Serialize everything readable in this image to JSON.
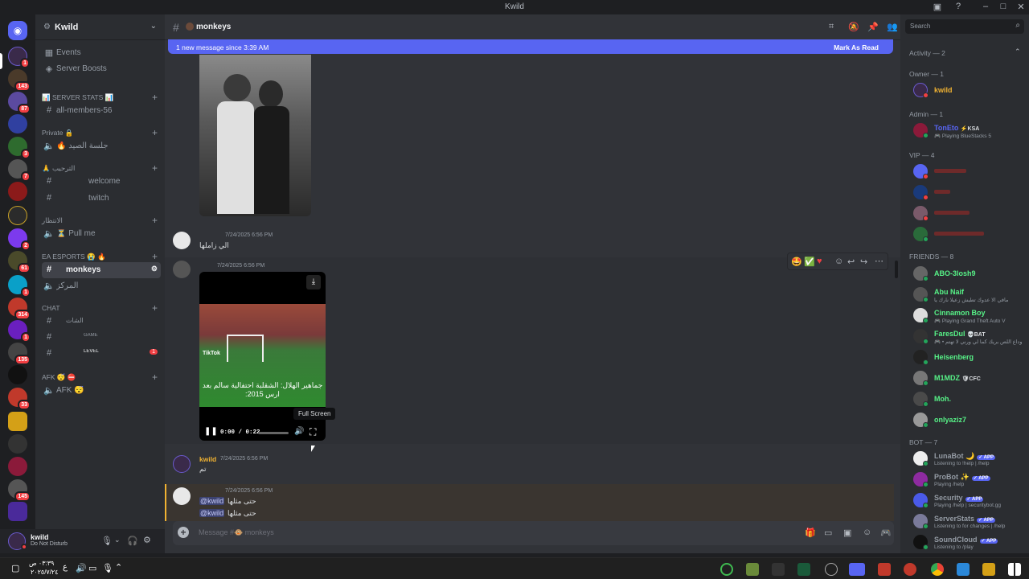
{
  "window": {
    "title": "Kwild"
  },
  "server": {
    "name": "Kwild",
    "events_label": "Events",
    "boosts_label": "Server Boosts"
  },
  "channels": {
    "server_stats_cat": "📊 SERVER STATS 📊",
    "all_members": "all-members-56",
    "private_cat": "Private 🔒",
    "private_voice": "🔥 جلسة الصيد",
    "welcome_cat": "🙏 الترحيب",
    "welcome": "welcome",
    "twitch": "twitch",
    "wait_cat": "الانتظار",
    "pull_me": "⏳ Pull me",
    "esports_cat": "EA ESPORTS 😭 🔥",
    "monkeys": "monkeys",
    "center": "المركز",
    "chat_cat": "CHAT",
    "chat1": "الشات",
    "chat2": "GAME",
    "chat3": "LEVEL",
    "chat3_badge": "1",
    "afk_cat": "AFK 😴 ⛔",
    "afk": "AFK 😴"
  },
  "user_panel": {
    "name": "kwild",
    "status": "Do Not Disturb"
  },
  "chat_header": {
    "channel": "monkeys"
  },
  "banner": {
    "text": "1 new message since 3:39 AM",
    "action": "Mark As Read"
  },
  "messages": [
    {
      "author": "",
      "time": "7/24/2025 6:56 PM",
      "text": "الي زاملها"
    },
    {
      "author": "",
      "time": "7/24/2025 6:56 PM",
      "video_time": "0:00 / 0:22",
      "video_caption": "جماهير الهلال: الشقلبة احتفالية سالم بعد ارس 2015:",
      "video_watermark": "TikTok",
      "tooltip": "Full Screen",
      "progress": 0.0
    },
    {
      "author": "kwild",
      "time": "7/24/2025 6:56 PM",
      "text": "تم"
    },
    {
      "author": "",
      "time": "7/24/2025 6:56 PM",
      "line1_mention": "@kwild",
      "line1_text": "حتى مثلها",
      "line2_mention": "@kwild",
      "line2_text": "حتى مثلها"
    }
  ],
  "composer": {
    "placeholder": "Message #🐵 monkeys"
  },
  "members": {
    "search_placeholder": "Search",
    "activity": "Activity — 2",
    "owner_cat": "Owner — 1",
    "admin_cat": "Admin — 1",
    "vip_cat": "VIP — 4",
    "friends_cat": "FRIENDS — 8",
    "bot_cat": "BOT — 7",
    "owner": [
      {
        "name": "kwild",
        "color": "#f0b232"
      }
    ],
    "admin": [
      {
        "name": "TonEto",
        "tag": "⚡KSA",
        "activity": "🎮 Playing BlueStacks 5",
        "color": "#5865f2"
      }
    ],
    "friends": [
      {
        "name": "ABO-3losh9",
        "activity": ""
      },
      {
        "name": "Abu Naif",
        "activity": "مافي الا عدوك تطيش زعيلا نارك يا"
      },
      {
        "name": "Cinnamon Boy",
        "activity": "🎮 Playing Grand Theft Auto V"
      },
      {
        "name": "FaresDul",
        "tag": "💀BAT",
        "activity": "🎮 • وداع اللص بريك كما لي ورني لا تهتم"
      },
      {
        "name": "Heisenberg",
        "activity": ""
      },
      {
        "name": "M1MDZ",
        "tag": "🛡CFC",
        "activity": ""
      },
      {
        "name": "Moh.",
        "activity": ""
      },
      {
        "name": "onlyaziz7",
        "activity": ""
      }
    ],
    "bots": [
      {
        "name": "LunaBot 🌙",
        "tag": "✓ APP",
        "activity": "Listening to !help | /help"
      },
      {
        "name": "ProBot ✨",
        "tag": "✓ APP",
        "activity": "Playing /help"
      },
      {
        "name": "Security",
        "tag": "✓ APP",
        "activity": "Playing /help | securitybot.gg"
      },
      {
        "name": "ServerStats",
        "tag": "✓ APP",
        "activity": "Listening to for changes | /help"
      },
      {
        "name": "SoundCloud",
        "tag": "✓ APP",
        "activity": "Listening to /play"
      }
    ]
  },
  "guild_badges": [
    "1",
    "143",
    "87",
    "3",
    "7",
    "314",
    "135",
    "33",
    "145",
    "61",
    "2",
    "1",
    "1",
    "1"
  ],
  "taskbar": {
    "time": "٠٣:٣٩ ص",
    "date": "٢٠٢٥/٧/٢٤",
    "lang": "ع"
  },
  "colors": {
    "accent": "#5865f2",
    "green": "#23a55a",
    "red": "#f23f43",
    "bg": "#313338"
  }
}
